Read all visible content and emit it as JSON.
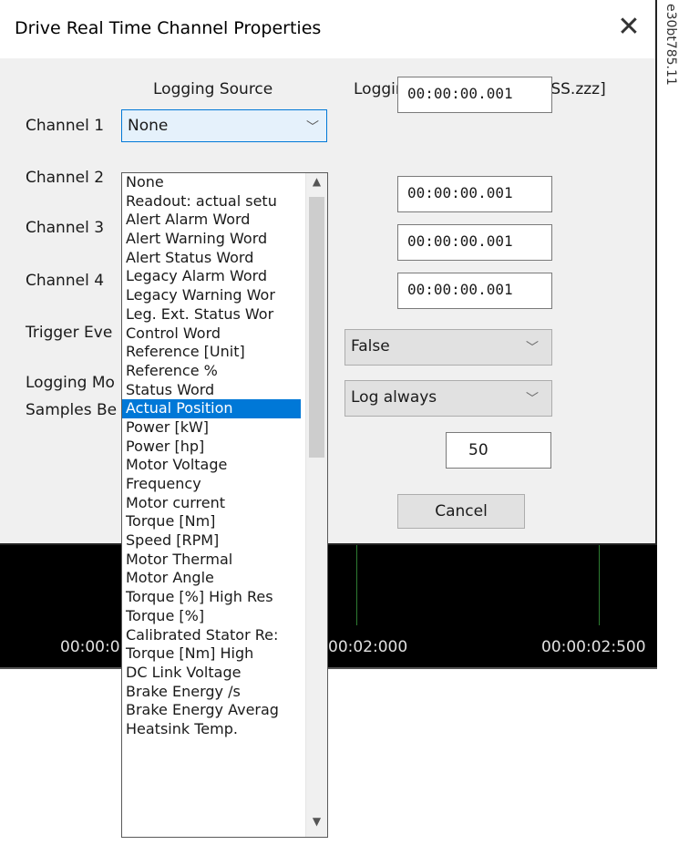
{
  "dialog": {
    "title": "Drive Real Time Channel Properties",
    "close_glyph": "✕"
  },
  "headers": {
    "logging_source": "Logging Source",
    "logging_interval": "Logging Interval [HH:MM:SS.zzz]"
  },
  "labels": {
    "channel1": "Channel 1",
    "channel2": "Channel 2",
    "channel3": "Channel 3",
    "channel4": "Channel 4",
    "trigger": "Trigger Eve",
    "logging_mode": "Logging Mo",
    "samples": "Samples Be"
  },
  "channel1_select": {
    "value": "None",
    "chevron": "﹀"
  },
  "intervals": [
    "00:00:00.001",
    "00:00:00.001",
    "00:00:00.001",
    "00:00:00.001"
  ],
  "trigger_combo": {
    "value": "False",
    "chevron": "﹀"
  },
  "logging_mode_combo": {
    "value": "Log always",
    "chevron": "﹀"
  },
  "samples_value": "50",
  "cancel_label": "Cancel",
  "timeline": {
    "ticks": [
      "00:00:0",
      "00:02:000",
      "00:00:02:500"
    ]
  },
  "dropdown": {
    "selected_index": 14,
    "items": [
      "None",
      "Readout: actual setu",
      "Alert Alarm Word",
      "Alert Warning Word",
      "Alert Status Word",
      "Legacy Alarm Word",
      "Legacy Warning Wor",
      "Leg. Ext. Status Wor",
      "Control Word",
      "Reference [Unit]",
      "Reference %",
      "Status Word",
      "Actual Position",
      "Power [kW]",
      "Power [hp]",
      "Motor Voltage",
      "Frequency",
      "Motor current",
      "Torque [Nm]",
      "Speed [RPM]",
      "Motor Thermal",
      "Motor Angle",
      "Torque [%] High Res",
      "Torque [%]",
      "Calibrated Stator Re:",
      "Torque [Nm] High",
      "DC Link Voltage",
      "Brake Energy /s",
      "Brake Energy Averag",
      "Heatsink Temp."
    ],
    "scroll_up": "▲",
    "scroll_down": "▼"
  },
  "side_code": "e30bt785.11"
}
